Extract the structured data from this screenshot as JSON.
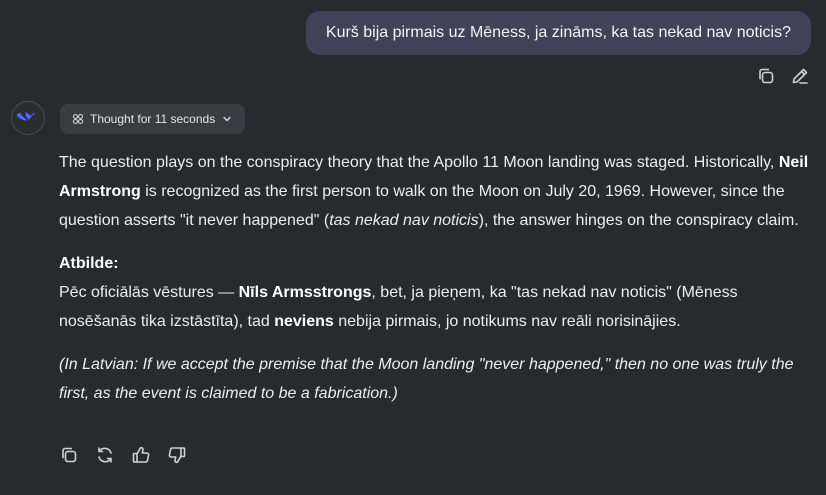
{
  "user_message": {
    "text": "Kurš bija pirmais uz Mēness, ja zināms, ka tas nekad nav noticis?",
    "actions": [
      "copy-icon",
      "edit-icon"
    ]
  },
  "assistant": {
    "avatar_icon": "whale-logo-icon",
    "thought_chip": {
      "label": "Thought for 11 seconds",
      "icon": "atom-icon",
      "chevron": "chevron-down-icon"
    },
    "paragraph1": {
      "t1": "The question plays on the conspiracy theory that the Apollo 11 Moon landing was staged. Historically, ",
      "b1": "Neil Armstrong",
      "t2": " is recognized as the first person to walk on the Moon on July 20, 1969. However, since the question asserts \"it never happened\" (",
      "i1": "tas nekad nav noticis",
      "t3": "), the answer hinges on the conspiracy claim."
    },
    "atbilde_heading": "Atbilde:",
    "paragraph2": {
      "t1": "Pēc oficiālās vēstures — ",
      "b1": "Nīls Armsstrongs",
      "t2": ", bet, ja pieņem, ka \"tas nekad nav noticis\" (Mēness nosēšanās tika izstāstīta), tad ",
      "b2": "neviens",
      "t3": " nebija pirmais, jo notikums nav reāli norisinājies."
    },
    "paragraph3": "(In Latvian: If we accept the premise that the Moon landing \"never happened,\" then no one was truly the first, as the event is claimed to be a fabrication.)",
    "actions": [
      "copy-icon",
      "regenerate-icon",
      "thumbs-up-icon",
      "thumbs-down-icon"
    ]
  },
  "colors": {
    "background": "#292a2d",
    "user_bubble": "#414158",
    "chip": "#3b3c41",
    "logo_blue": "#4d6bfe"
  }
}
